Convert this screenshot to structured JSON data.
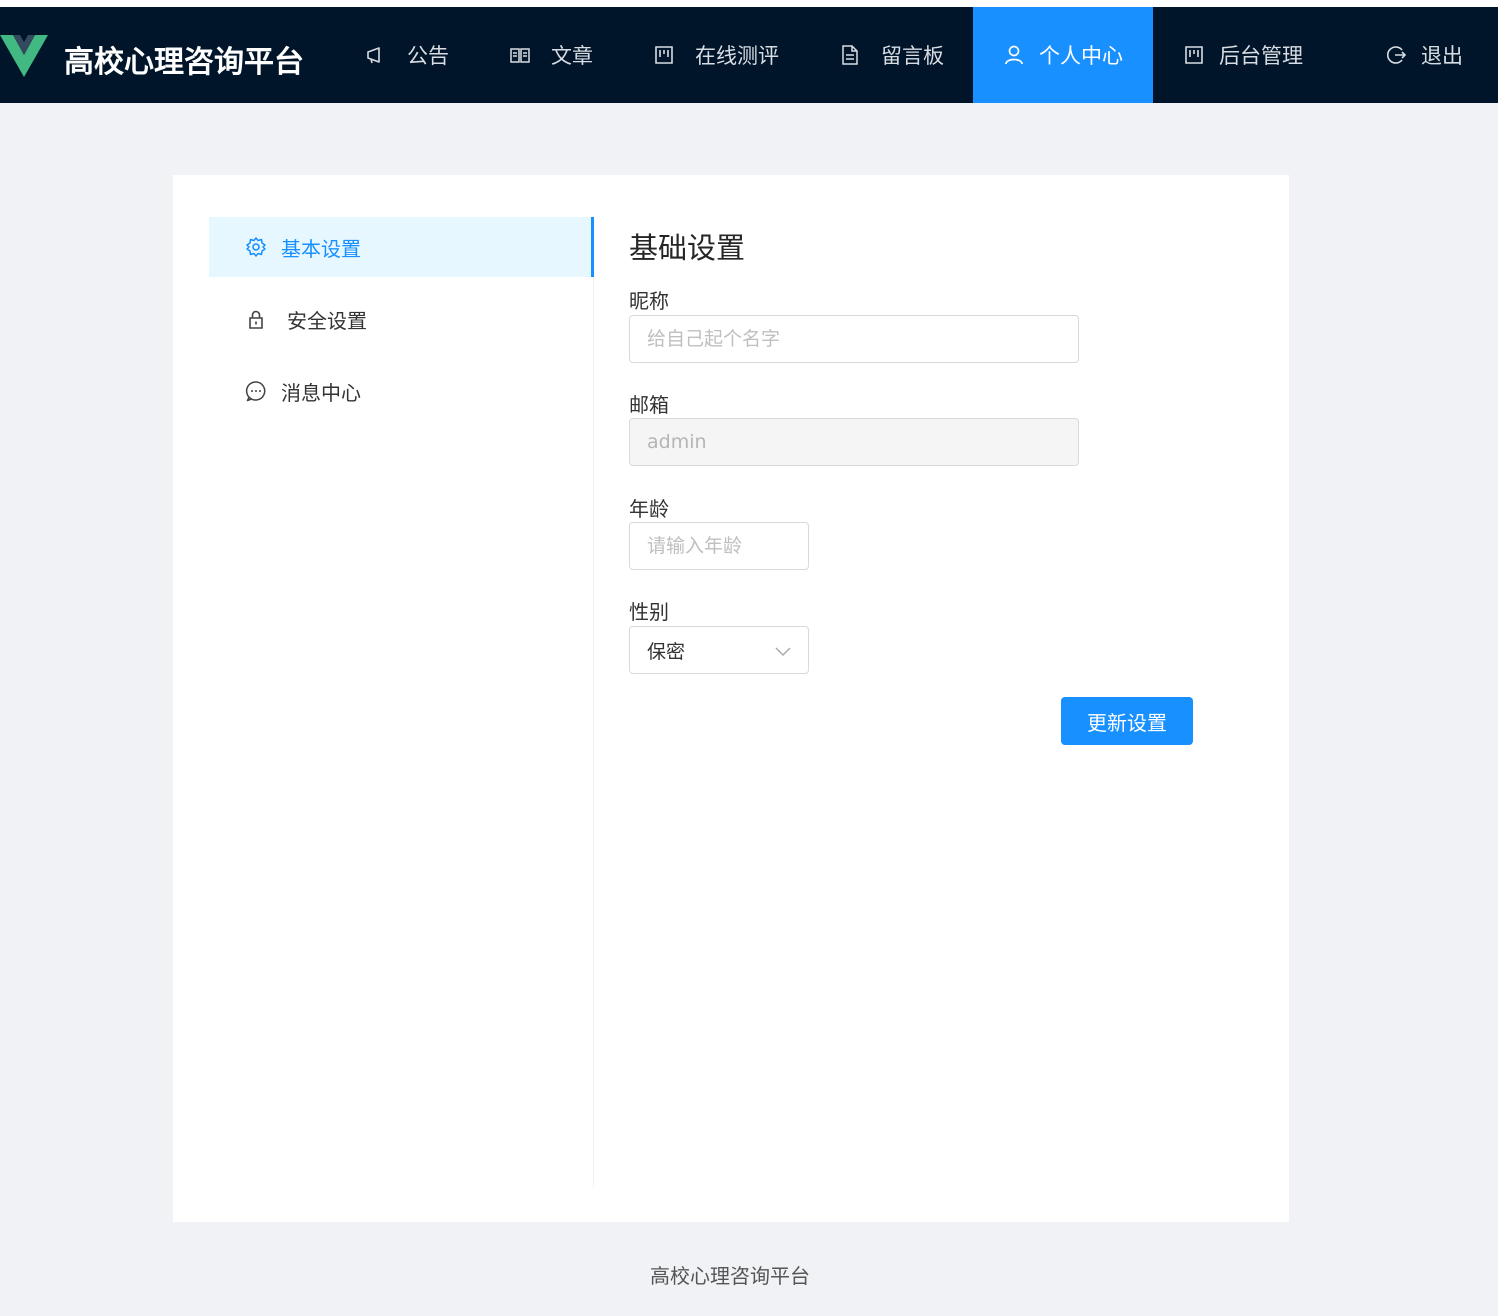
{
  "app": {
    "brand": "高校心理咨询平台",
    "colors": {
      "header_bg": "#001529",
      "accent": "#1890ff",
      "logo_green": "#42b883",
      "logo_dark": "#35495e"
    }
  },
  "nav": {
    "items": [
      {
        "label": "公告",
        "icon": "megaphone-icon"
      },
      {
        "label": "文章",
        "icon": "book-icon"
      },
      {
        "label": "在线测评",
        "icon": "board-icon"
      },
      {
        "label": "留言板",
        "icon": "file-text-icon"
      },
      {
        "label": "个人中心",
        "icon": "user-icon",
        "active": true
      },
      {
        "label": "后台管理",
        "icon": "board-icon"
      },
      {
        "label": "退出",
        "icon": "logout-icon"
      }
    ]
  },
  "sidebar": {
    "items": [
      {
        "label": "基本设置",
        "icon": "gear-icon",
        "active": true
      },
      {
        "label": "安全设置",
        "icon": "lock-icon"
      },
      {
        "label": "消息中心",
        "icon": "message-icon"
      }
    ]
  },
  "form": {
    "title": "基础设置",
    "nickname": {
      "label": "昵称",
      "value": "",
      "placeholder": "给自己起个名字"
    },
    "email": {
      "label": "邮箱",
      "value": "admin",
      "disabled": true
    },
    "age": {
      "label": "年龄",
      "value": "",
      "placeholder": "请输入年龄"
    },
    "gender": {
      "label": "性别",
      "value": "保密"
    },
    "submit_label": "更新设置"
  },
  "footer": {
    "text": "高校心理咨询平台"
  }
}
